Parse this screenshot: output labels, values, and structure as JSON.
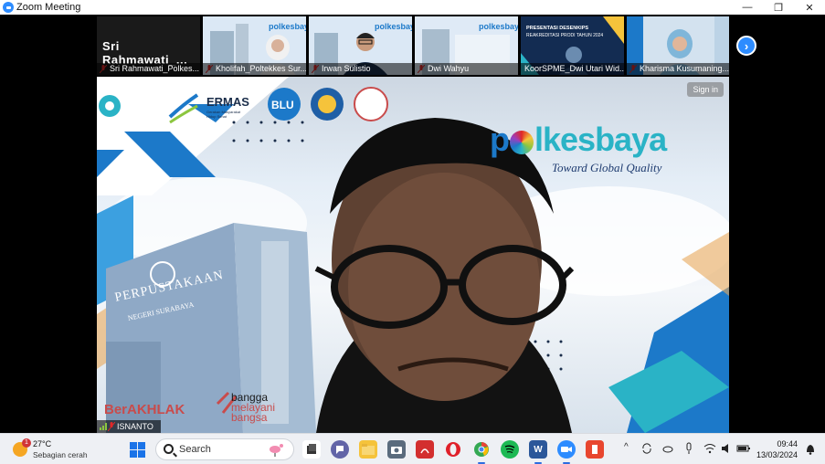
{
  "window": {
    "title": "Zoom Meeting",
    "controls": [
      "minimize",
      "restore",
      "close"
    ]
  },
  "thumbnails": [
    {
      "name": "Sri Rahmawati_Polkes...",
      "display_big": "Sri  Rahmawati_...",
      "muted": true,
      "video": false
    },
    {
      "name": "Kholifah_Poltekkes Sur...",
      "muted": true,
      "video": true
    },
    {
      "name": "Irwan Sulistio",
      "muted": true,
      "video": true
    },
    {
      "name": "Dwi Wahyu",
      "muted": true,
      "video": true
    },
    {
      "name": "KoorSPME_Dwi Utari Wid...",
      "muted": false,
      "video": true,
      "slide_title": "PRESENTASI DESENKIPS",
      "slide_sub": "REAKREDITASI PRODI TAHUN 2024"
    },
    {
      "name": "Kharisma Kusumaning...",
      "muted": true,
      "video": true
    }
  ],
  "main": {
    "speaker_name": "ISNANTO",
    "sign_in_label": "Sign in",
    "background": {
      "logo_text": "polkesbaya",
      "logo_prefix": "p",
      "logo_suffix": "lkesbaya",
      "tagline": "Toward Global Quality",
      "building_text": "PERPUSTAKAAN",
      "building_sub": "NEGERI SURABAYA",
      "germas_label": "ERMAS",
      "germas_sub": "Gerakan Masyarakat Hidup Sehat",
      "blu_label": "BLU",
      "berakhlak_label": "BerAKHLAK",
      "bangga_line1": "bangga",
      "bangga_line2": "melayani",
      "bangga_line3": "bangsa"
    }
  },
  "taskbar": {
    "weather": {
      "temp": "27°C",
      "condition": "Sebagian cerah",
      "badge": "1"
    },
    "search_label": "Search",
    "apps": [
      "files",
      "chat",
      "file-explorer",
      "camera",
      "pdf",
      "opera",
      "chrome",
      "spotify",
      "word",
      "zoom",
      "app"
    ],
    "clock": {
      "time": "09:44",
      "date": "13/03/2024"
    }
  },
  "colors": {
    "zoom_blue": "#2d8cff",
    "polkes_blue": "#1c79c9",
    "polkes_teal": "#2ab3c6"
  }
}
